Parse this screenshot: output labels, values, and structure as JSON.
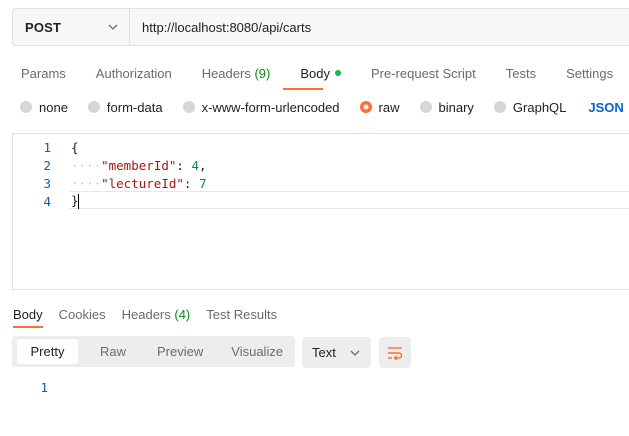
{
  "request": {
    "method": "POST",
    "url": "http://localhost:8080/api/carts"
  },
  "request_tabs": [
    {
      "label": "Params"
    },
    {
      "label": "Authorization"
    },
    {
      "label": "Headers",
      "count": "(9)"
    },
    {
      "label": "Body",
      "active": true,
      "indicator": "green-dot"
    },
    {
      "label": "Pre-request Script"
    },
    {
      "label": "Tests"
    },
    {
      "label": "Settings"
    }
  ],
  "body_types": [
    {
      "label": "none",
      "selected": false
    },
    {
      "label": "form-data",
      "selected": false
    },
    {
      "label": "x-www-form-urlencoded",
      "selected": false
    },
    {
      "label": "raw",
      "selected": true
    },
    {
      "label": "binary",
      "selected": false
    },
    {
      "label": "GraphQL",
      "selected": false
    }
  ],
  "raw_format": "JSON",
  "editor": {
    "lines": [
      {
        "n": "1",
        "text": "{"
      },
      {
        "n": "2",
        "key": "\"memberId\"",
        "sep": ": ",
        "value": "4",
        "tail": ","
      },
      {
        "n": "3",
        "key": "\"lectureId\"",
        "sep": ": ",
        "value": "7",
        "tail": ""
      },
      {
        "n": "4",
        "text": "}"
      }
    ]
  },
  "response_tabs": [
    {
      "label": "Body",
      "active": true
    },
    {
      "label": "Cookies"
    },
    {
      "label": "Headers",
      "count": "(4)"
    },
    {
      "label": "Test Results"
    }
  ],
  "response_views": [
    "Pretty",
    "Raw",
    "Preview",
    "Visualize"
  ],
  "response_active_view": "Pretty",
  "response_format": "Text",
  "response_lines": [
    "1"
  ],
  "colors": {
    "accent": "#ff6c37",
    "link_blue": "#0265d2",
    "count_green": "#0c8a1e",
    "json_key": "#a31515",
    "json_number": "#098658"
  },
  "icons": {
    "method_dropdown": "chevron-down-icon",
    "format_dropdown": "chevron-down-icon",
    "wrap": "wrap-lines-icon"
  }
}
